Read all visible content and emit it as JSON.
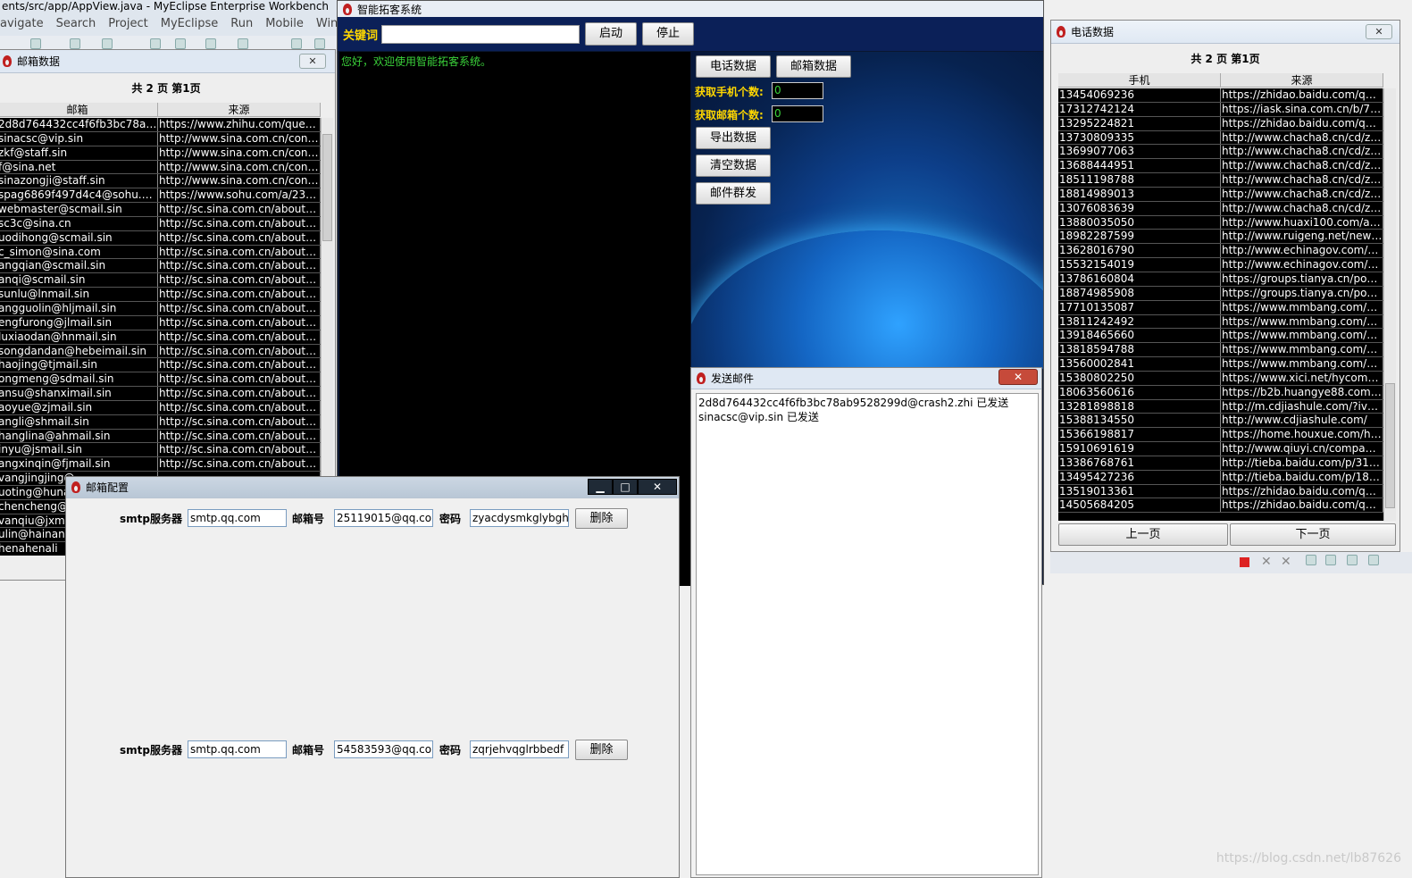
{
  "eclipse": {
    "title": "ents/src/app/AppView.java - MyEclipse Enterprise Workbench",
    "menu": [
      "avigate",
      "Search",
      "Project",
      "MyEclipse",
      "Run",
      "Mobile",
      "Window"
    ]
  },
  "main_window": {
    "title": "智能拓客系统",
    "keyword_label": "关键词",
    "keyword_value": "",
    "start_button": "启动",
    "stop_button": "停止",
    "console_text": "您好，欢迎使用智能拓客系统。",
    "phone_data_button": "电话数据",
    "email_data_button": "邮箱数据",
    "phone_count_label": "获取手机个数:",
    "phone_count_value": "0",
    "email_count_label": "获取邮箱个数:",
    "email_count_value": "0",
    "export_button": "导出数据",
    "clear_button": "清空数据",
    "mass_mail_button": "邮件群发"
  },
  "send_mail_window": {
    "title": "发送邮件",
    "close": "✕",
    "log_lines": [
      "2d8d764432cc4f6fb3bc78ab9528299d@crash2.zhi 已发送",
      "sinacsc@vip.sin 已发送"
    ]
  },
  "config_window": {
    "title": "邮箱配置",
    "controls": [
      "▁",
      "□",
      "✕"
    ],
    "rows": [
      {
        "server_label": "smtp服务器",
        "server": "smtp.qq.com",
        "account_label": "邮箱号",
        "account": "25119015@qq.com",
        "password_label": "密码",
        "password": "zyacdysmkglybghj",
        "delete_button": "删除"
      },
      {
        "server_label": "smtp服务器",
        "server": "smtp.qq.com",
        "account_label": "邮箱号",
        "account": "54583593@qq.com",
        "password_label": "密码",
        "password": "zqrjehvqglrbbedf",
        "delete_button": "删除"
      }
    ]
  },
  "phone_window": {
    "title": "电话数据",
    "close": "✕",
    "pager": "共 2 页  第1页",
    "headers": [
      "手机",
      "来源"
    ],
    "prev_button": "上一页",
    "next_button": "下一页",
    "rows": [
      [
        "13454069236",
        "https://zhidao.baidu.com/questi..."
      ],
      [
        "17312742124",
        "https://iask.sina.com.cn/b/7468..."
      ],
      [
        "13295224821",
        "https://zhidao.baidu.com/questi..."
      ],
      [
        "13730809335",
        "http://www.chacha8.cn/cd/zhijia..."
      ],
      [
        "13699077063",
        "http://www.chacha8.cn/cd/zhijia..."
      ],
      [
        "13688444951",
        "http://www.chacha8.cn/cd/zhijia..."
      ],
      [
        "18511198788",
        "http://www.chacha8.cn/cd/zhijia..."
      ],
      [
        "18814989013",
        "http://www.chacha8.cn/cd/zhijia..."
      ],
      [
        "13076083639",
        "http://www.chacha8.cn/cd/zhijia..."
      ],
      [
        "13880035050",
        "http://www.huaxi100.com/about..."
      ],
      [
        "18982287599",
        "http://www.ruigeng.net/newsdet..."
      ],
      [
        "13628016790",
        "http://www.echinagov.com/qyne..."
      ],
      [
        "15532154019",
        "http://www.echinagov.com/abo..."
      ],
      [
        "13786160804",
        "https://groups.tianya.cn/post-sy..."
      ],
      [
        "18874985908",
        "https://groups.tianya.cn/post-sy..."
      ],
      [
        "17710135087",
        "https://www.mmbang.com/abo..."
      ],
      [
        "13811242492",
        "https://www.mmbang.com/abo..."
      ],
      [
        "13918465660",
        "https://www.mmbang.com/abo..."
      ],
      [
        "13818594788",
        "https://www.mmbang.com/abo..."
      ],
      [
        "13560002841",
        "https://www.mmbang.com/abo..."
      ],
      [
        "15380802250",
        "https://www.xici.net/hycompany..."
      ],
      [
        "18063560616",
        "https://b2b.huangye88.com/go..."
      ],
      [
        "13281898818",
        "http://m.cdjiashule.com/?ivk_s..."
      ],
      [
        "15388134550",
        "http://www.cdjiashule.com/"
      ],
      [
        "15366198817",
        "https://home.houxue.com/help/..."
      ],
      [
        "15910691619",
        "http://www.qiuyi.cn/company/co..."
      ],
      [
        "13386768761",
        "http://tieba.baidu.com/p/31394..."
      ],
      [
        "13495427236",
        "http://tieba.baidu.com/p/18531..."
      ],
      [
        "13519013361",
        "https://zhidao.baidu.com/questi..."
      ],
      [
        "14505684205",
        "https://zhidao.baidu.com/questi..."
      ]
    ]
  },
  "mail_window": {
    "title": "邮箱数据",
    "close": "✕",
    "pager": "共 2 页  第1页",
    "headers": [
      "邮箱",
      "来源"
    ],
    "rows": [
      [
        "2d8d764432cc4f6fb3bc78ab95...",
        "https://www.zhihu.com/questio..."
      ],
      [
        "sinacsc@vip.sin",
        "http://www.sina.com.cn/contact..."
      ],
      [
        "zkf@staff.sin",
        "http://www.sina.com.cn/contact..."
      ],
      [
        "f@sina.net",
        "http://www.sina.com.cn/contact..."
      ],
      [
        "sinazongji@staff.sin",
        "http://www.sina.com.cn/contact..."
      ],
      [
        "spag6869f497d4c4@sohu.com",
        "https://www.sohu.com/a/23082..."
      ],
      [
        "webmaster@scmail.sin",
        "http://sc.sina.com.cn/about/ind..."
      ],
      [
        "sc3c@sina.cn",
        "http://sc.sina.com.cn/about/ind..."
      ],
      [
        "uodihong@scmail.sin",
        "http://sc.sina.com.cn/about/ind..."
      ],
      [
        "c_simon@sina.com",
        "http://sc.sina.com.cn/about/ind..."
      ],
      [
        "angqian@scmail.sin",
        "http://sc.sina.com.cn/about/ind..."
      ],
      [
        "anqi@scmail.sin",
        "http://sc.sina.com.cn/about/ind..."
      ],
      [
        "sunlu@lnmail.sin",
        "http://sc.sina.com.cn/about/ind..."
      ],
      [
        "angguolin@hljmail.sin",
        "http://sc.sina.com.cn/about/ind..."
      ],
      [
        "engfurong@jlmail.sin",
        "http://sc.sina.com.cn/about/ind..."
      ],
      [
        "luxiaodan@hnmail.sin",
        "http://sc.sina.com.cn/about/ind..."
      ],
      [
        "songdandan@hebeimail.sin",
        "http://sc.sina.com.cn/about/ind..."
      ],
      [
        "haojing@tjmail.sin",
        "http://sc.sina.com.cn/about/ind..."
      ],
      [
        "ongmeng@sdmail.sin",
        "http://sc.sina.com.cn/about/ind..."
      ],
      [
        "ansu@shanximail.sin",
        "http://sc.sina.com.cn/about/ind..."
      ],
      [
        "aoyue@zjmail.sin",
        "http://sc.sina.com.cn/about/ind..."
      ],
      [
        "angli@shmail.sin",
        "http://sc.sina.com.cn/about/ind..."
      ],
      [
        "hanglina@ahmail.sin",
        "http://sc.sina.com.cn/about/ind..."
      ],
      [
        "inyu@jsmail.sin",
        "http://sc.sina.com.cn/about/ind..."
      ],
      [
        "angxinqin@fjmail.sin",
        "http://sc.sina.com.cn/about/ind..."
      ],
      [
        "vangjingjing@",
        ""
      ],
      [
        "uoting@huna",
        ""
      ],
      [
        "chencheng@f",
        ""
      ],
      [
        "vanqiu@jxma",
        ""
      ],
      [
        "ulin@hainanı",
        ""
      ],
      [
        "henahenali",
        ""
      ]
    ]
  },
  "watermark": "https://blog.csdn.net/lb87626"
}
